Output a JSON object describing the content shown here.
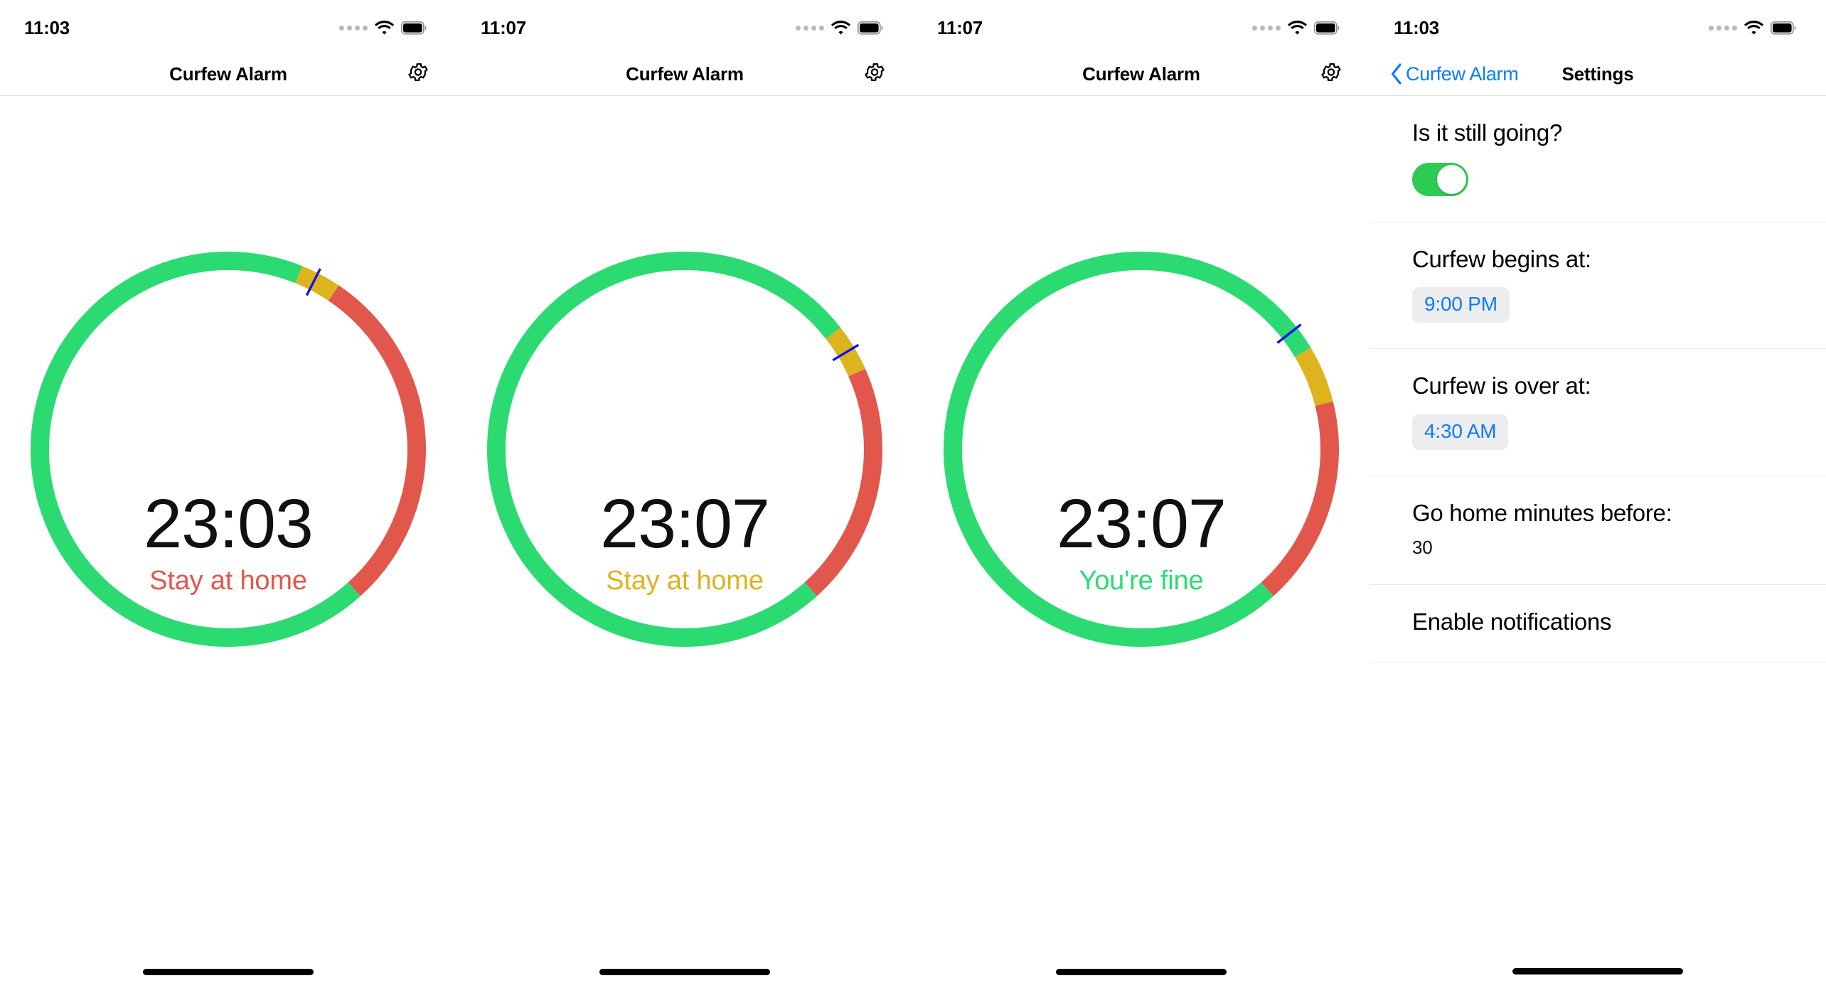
{
  "app": {
    "title": "Curfew Alarm",
    "accent_blue": "#0a7bff",
    "green": "#2BDB72",
    "red": "#E2574C",
    "yellow": "#DDB31E"
  },
  "screens": [
    {
      "status_bar": {
        "time": "11:03",
        "signal_icon": "signal-dots-icon",
        "wifi_icon": "wifi-icon",
        "battery_icon": "battery-full-icon"
      },
      "nav": {
        "title": "Curfew Alarm",
        "gear_icon": "gear-icon"
      },
      "gauge": {
        "time": "23:03",
        "status": "Stay at home",
        "status_color": "#E2574C",
        "marker_angle": -63,
        "segments": [
          {
            "name": "green-before",
            "color": "#2BDB72",
            "start": -90,
            "end": -68
          },
          {
            "name": "yellow",
            "color": "#DDB31E",
            "start": -68,
            "end": -56
          },
          {
            "name": "red",
            "color": "#E2574C",
            "start": -56,
            "end": 48
          },
          {
            "name": "green-after",
            "color": "#2BDB72",
            "start": 48,
            "end": 270
          }
        ]
      },
      "home_indicator": "home-indicator"
    },
    {
      "status_bar": {
        "time": "11:07",
        "signal_icon": "signal-dots-icon",
        "wifi_icon": "wifi-icon",
        "battery_icon": "battery-full-icon"
      },
      "nav": {
        "title": "Curfew Alarm",
        "gear_icon": "gear-icon"
      },
      "gauge": {
        "time": "23:07",
        "status": "Stay at home",
        "status_color": "#DDB31E",
        "marker_angle": -31,
        "segments": [
          {
            "name": "green-before",
            "color": "#2BDB72",
            "start": -90,
            "end": -38
          },
          {
            "name": "yellow",
            "color": "#DDB31E",
            "start": -38,
            "end": -24
          },
          {
            "name": "red",
            "color": "#E2574C",
            "start": -24,
            "end": 48
          },
          {
            "name": "green-after",
            "color": "#2BDB72",
            "start": 48,
            "end": 270
          }
        ]
      },
      "home_indicator": "home-indicator"
    },
    {
      "status_bar": {
        "time": "11:07",
        "signal_icon": "signal-dots-icon",
        "wifi_icon": "wifi-icon",
        "battery_icon": "battery-full-icon"
      },
      "nav": {
        "title": "Curfew Alarm",
        "gear_icon": "gear-icon"
      },
      "gauge": {
        "time": "23:07",
        "status": "You're fine",
        "status_color": "#2BDB72",
        "marker_angle": -38,
        "segments": [
          {
            "name": "green-before",
            "color": "#2BDB72",
            "start": -90,
            "end": -31
          },
          {
            "name": "yellow",
            "color": "#DDB31E",
            "start": -31,
            "end": -14
          },
          {
            "name": "red",
            "color": "#E2574C",
            "start": -14,
            "end": 48
          },
          {
            "name": "green-after",
            "color": "#2BDB72",
            "start": 48,
            "end": 270
          }
        ]
      },
      "home_indicator": "home-indicator"
    }
  ],
  "settings_screen": {
    "status_bar": {
      "time": "11:03",
      "signal_icon": "signal-dots-icon",
      "wifi_icon": "wifi-icon",
      "battery_icon": "battery-full-icon"
    },
    "nav": {
      "back_label": "Curfew Alarm",
      "back_icon": "chevron-left-icon",
      "title": "Settings"
    },
    "rows": [
      {
        "label": "Is it still going?",
        "control": "toggle",
        "toggle_on": true
      },
      {
        "label": "Curfew begins at:",
        "control": "time-chip",
        "value": "9:00 PM"
      },
      {
        "label": "Curfew is over at:",
        "control": "time-chip",
        "value": "4:30 AM"
      },
      {
        "label": "Go home minutes before:",
        "control": "number",
        "value": "30"
      },
      {
        "label": "Enable notifications",
        "control": "none",
        "value": ""
      }
    ],
    "home_indicator": "home-indicator"
  }
}
